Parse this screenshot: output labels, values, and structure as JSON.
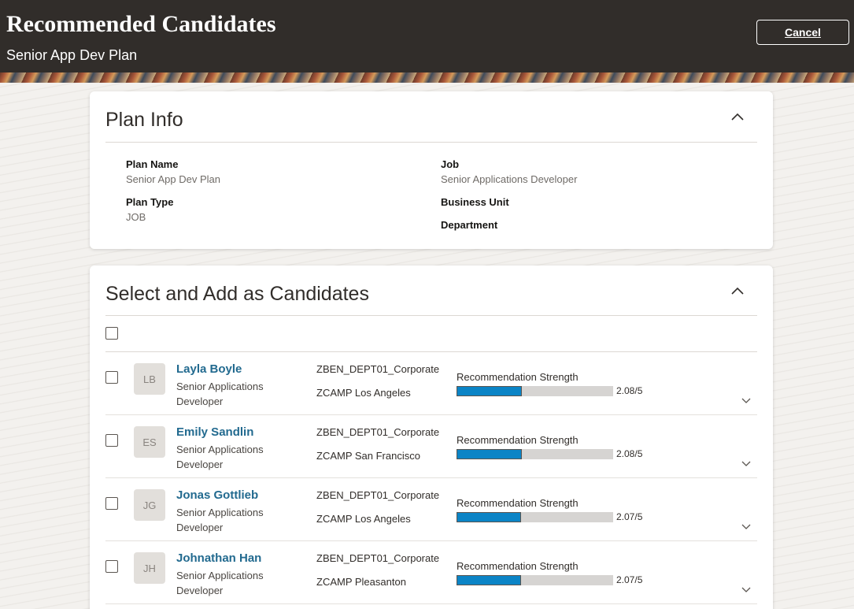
{
  "header": {
    "title": "Recommended Candidates",
    "subtitle": "Senior App Dev Plan",
    "cancel_label": "Cancel"
  },
  "plan_info": {
    "title": "Plan Info",
    "plan_name_label": "Plan Name",
    "plan_name_value": "Senior App Dev Plan",
    "plan_type_label": "Plan Type",
    "plan_type_value": "JOB",
    "job_label": "Job",
    "job_value": "Senior Applications Developer",
    "business_unit_label": "Business Unit",
    "department_label": "Department"
  },
  "candidates_section": {
    "title": "Select and Add as Candidates",
    "strength_label": "Recommendation Strength",
    "rows": [
      {
        "initials": "LB",
        "name": "Layla Boyle",
        "job": "Senior Applications Developer",
        "department": "ZBEN_DEPT01_Corporate",
        "location": "ZCAMP Los Angeles",
        "strength": 2.08,
        "strength_text": "2.08/5"
      },
      {
        "initials": "ES",
        "name": "Emily Sandlin",
        "job": "Senior Applications Developer",
        "department": "ZBEN_DEPT01_Corporate",
        "location": "ZCAMP San Francisco",
        "strength": 2.08,
        "strength_text": "2.08/5"
      },
      {
        "initials": "JG",
        "name": "Jonas Gottlieb",
        "job": "Senior Applications Developer",
        "department": "ZBEN_DEPT01_Corporate",
        "location": "ZCAMP Los Angeles",
        "strength": 2.07,
        "strength_text": "2.07/5"
      },
      {
        "initials": "JH",
        "name": "Johnathan Han",
        "job": "Senior Applications Developer",
        "department": "ZBEN_DEPT01_Corporate",
        "location": "ZCAMP Pleasanton",
        "strength": 2.07,
        "strength_text": "2.07/5"
      }
    ]
  },
  "colors": {
    "header_bg": "#312d2a",
    "link": "#226a8f",
    "strength_fill": "#0b84c6",
    "strength_track": "#d6d4d2"
  },
  "icons": {
    "collapse": "chevron-up-icon",
    "expand": "chevron-down-icon"
  }
}
